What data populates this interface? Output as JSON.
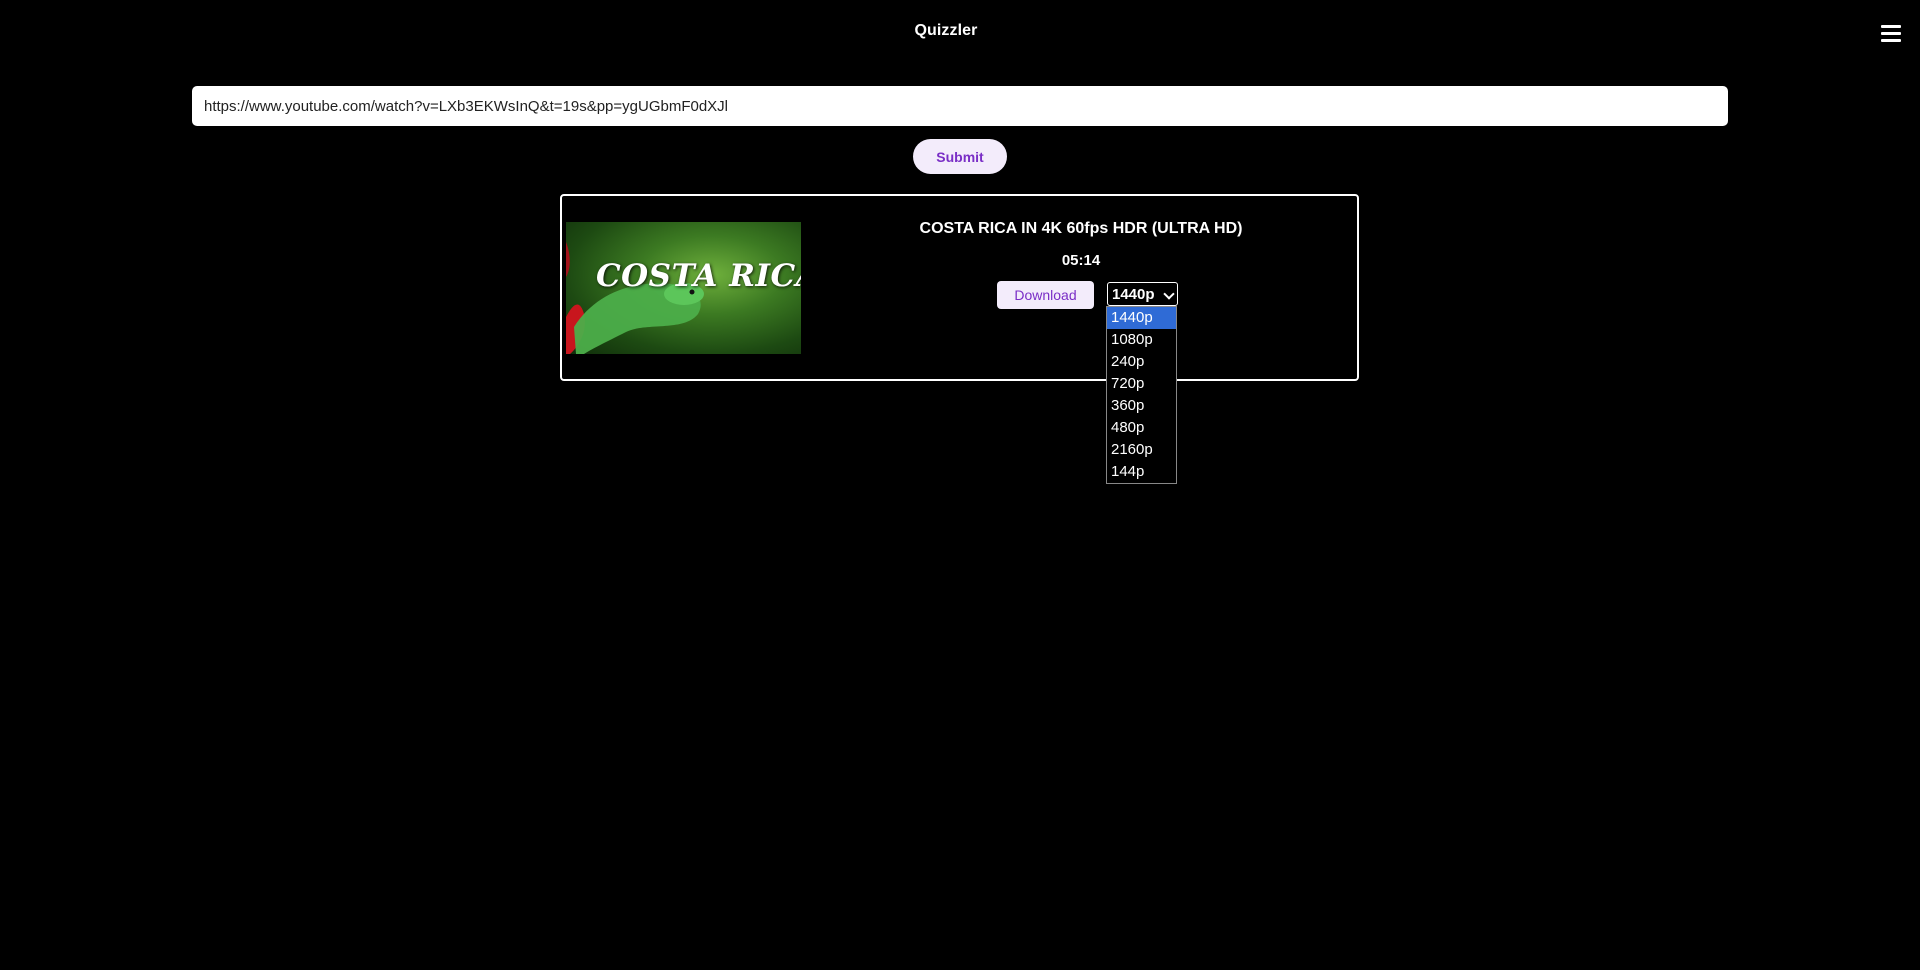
{
  "header": {
    "title": "Quizzler",
    "menu_icon": "hamburger-menu-icon"
  },
  "search": {
    "url_value": "https://www.youtube.com/watch?v=LXb3EKWsInQ&t=19s&pp=ygUGbmF0dXJl",
    "submit_label": "Submit"
  },
  "video": {
    "thumbnail_text": "COSTA RICA",
    "title": "COSTA RICA IN 4K 60fps HDR (ULTRA HD)",
    "duration": "05:14",
    "download_label": "Download",
    "selected_quality": "1440p",
    "quality_options": [
      "1440p",
      "1080p",
      "240p",
      "720p",
      "360p",
      "480p",
      "2160p",
      "144p"
    ]
  },
  "colors": {
    "background": "#000000",
    "button_bg": "#f3ecfb",
    "button_text": "#7a2ec6",
    "selected_option": "#2f6bd6"
  }
}
